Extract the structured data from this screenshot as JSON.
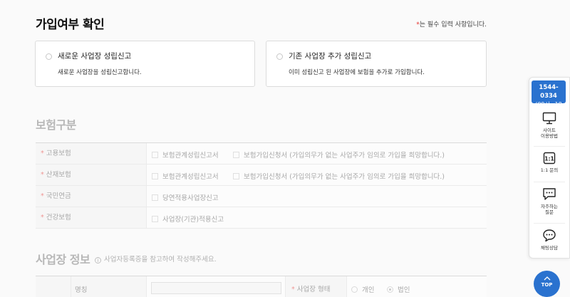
{
  "header": {
    "title": "가입여부 확인",
    "required_star": "*",
    "required_note": "는 필수 입력 사항입니다."
  },
  "options": {
    "new": {
      "title": "새로운 사업장 성립신고",
      "desc": "새로운 사업장을 성립신고합니다."
    },
    "add": {
      "title": "기존 사업장 추가 성립신고",
      "desc": "이미 성립신고 된 사업장에 보험을 추가로 가입합니다."
    }
  },
  "insurance": {
    "title": "보험구분",
    "required_star": "*",
    "rows": [
      {
        "label": "고용보험",
        "opt1": "보험관계성립신고서",
        "opt2": "보험가입신청서 (가입의무가 없는 사업주가 임의로 가입을 희망합니다.)"
      },
      {
        "label": "산재보험",
        "opt1": "보험관계성립신고서",
        "opt2": "보험가입신청서 (가입의무가 없는 사업주가 임의로 가입을 희망합니다.)"
      },
      {
        "label": "국민연금",
        "opt1": "당연적용사업장신고"
      },
      {
        "label": "건강보험",
        "opt1": "사업장(기관)적용신고"
      }
    ]
  },
  "business": {
    "title": "사업장 정보",
    "hint_icon": "i",
    "hint": "사업자등록증을 참고하여 작성해주세요.",
    "name_label": "명칭",
    "type_star": "*",
    "type_label": "사업장 형태",
    "type_individual": "개인",
    "type_corporate": "법인"
  },
  "sidebar": {
    "phone": "1544-0334",
    "hours": "(09시~18시)",
    "guide_line1": "사이트",
    "guide_line2": "이용방법",
    "inquiry": "1:1 문의",
    "faq_line1": "자주하는",
    "faq_line2": "질문",
    "chat": "채팅상담",
    "top": "TOP"
  },
  "colors": {
    "accent": "#2a72cf",
    "required": "#e5322d"
  }
}
